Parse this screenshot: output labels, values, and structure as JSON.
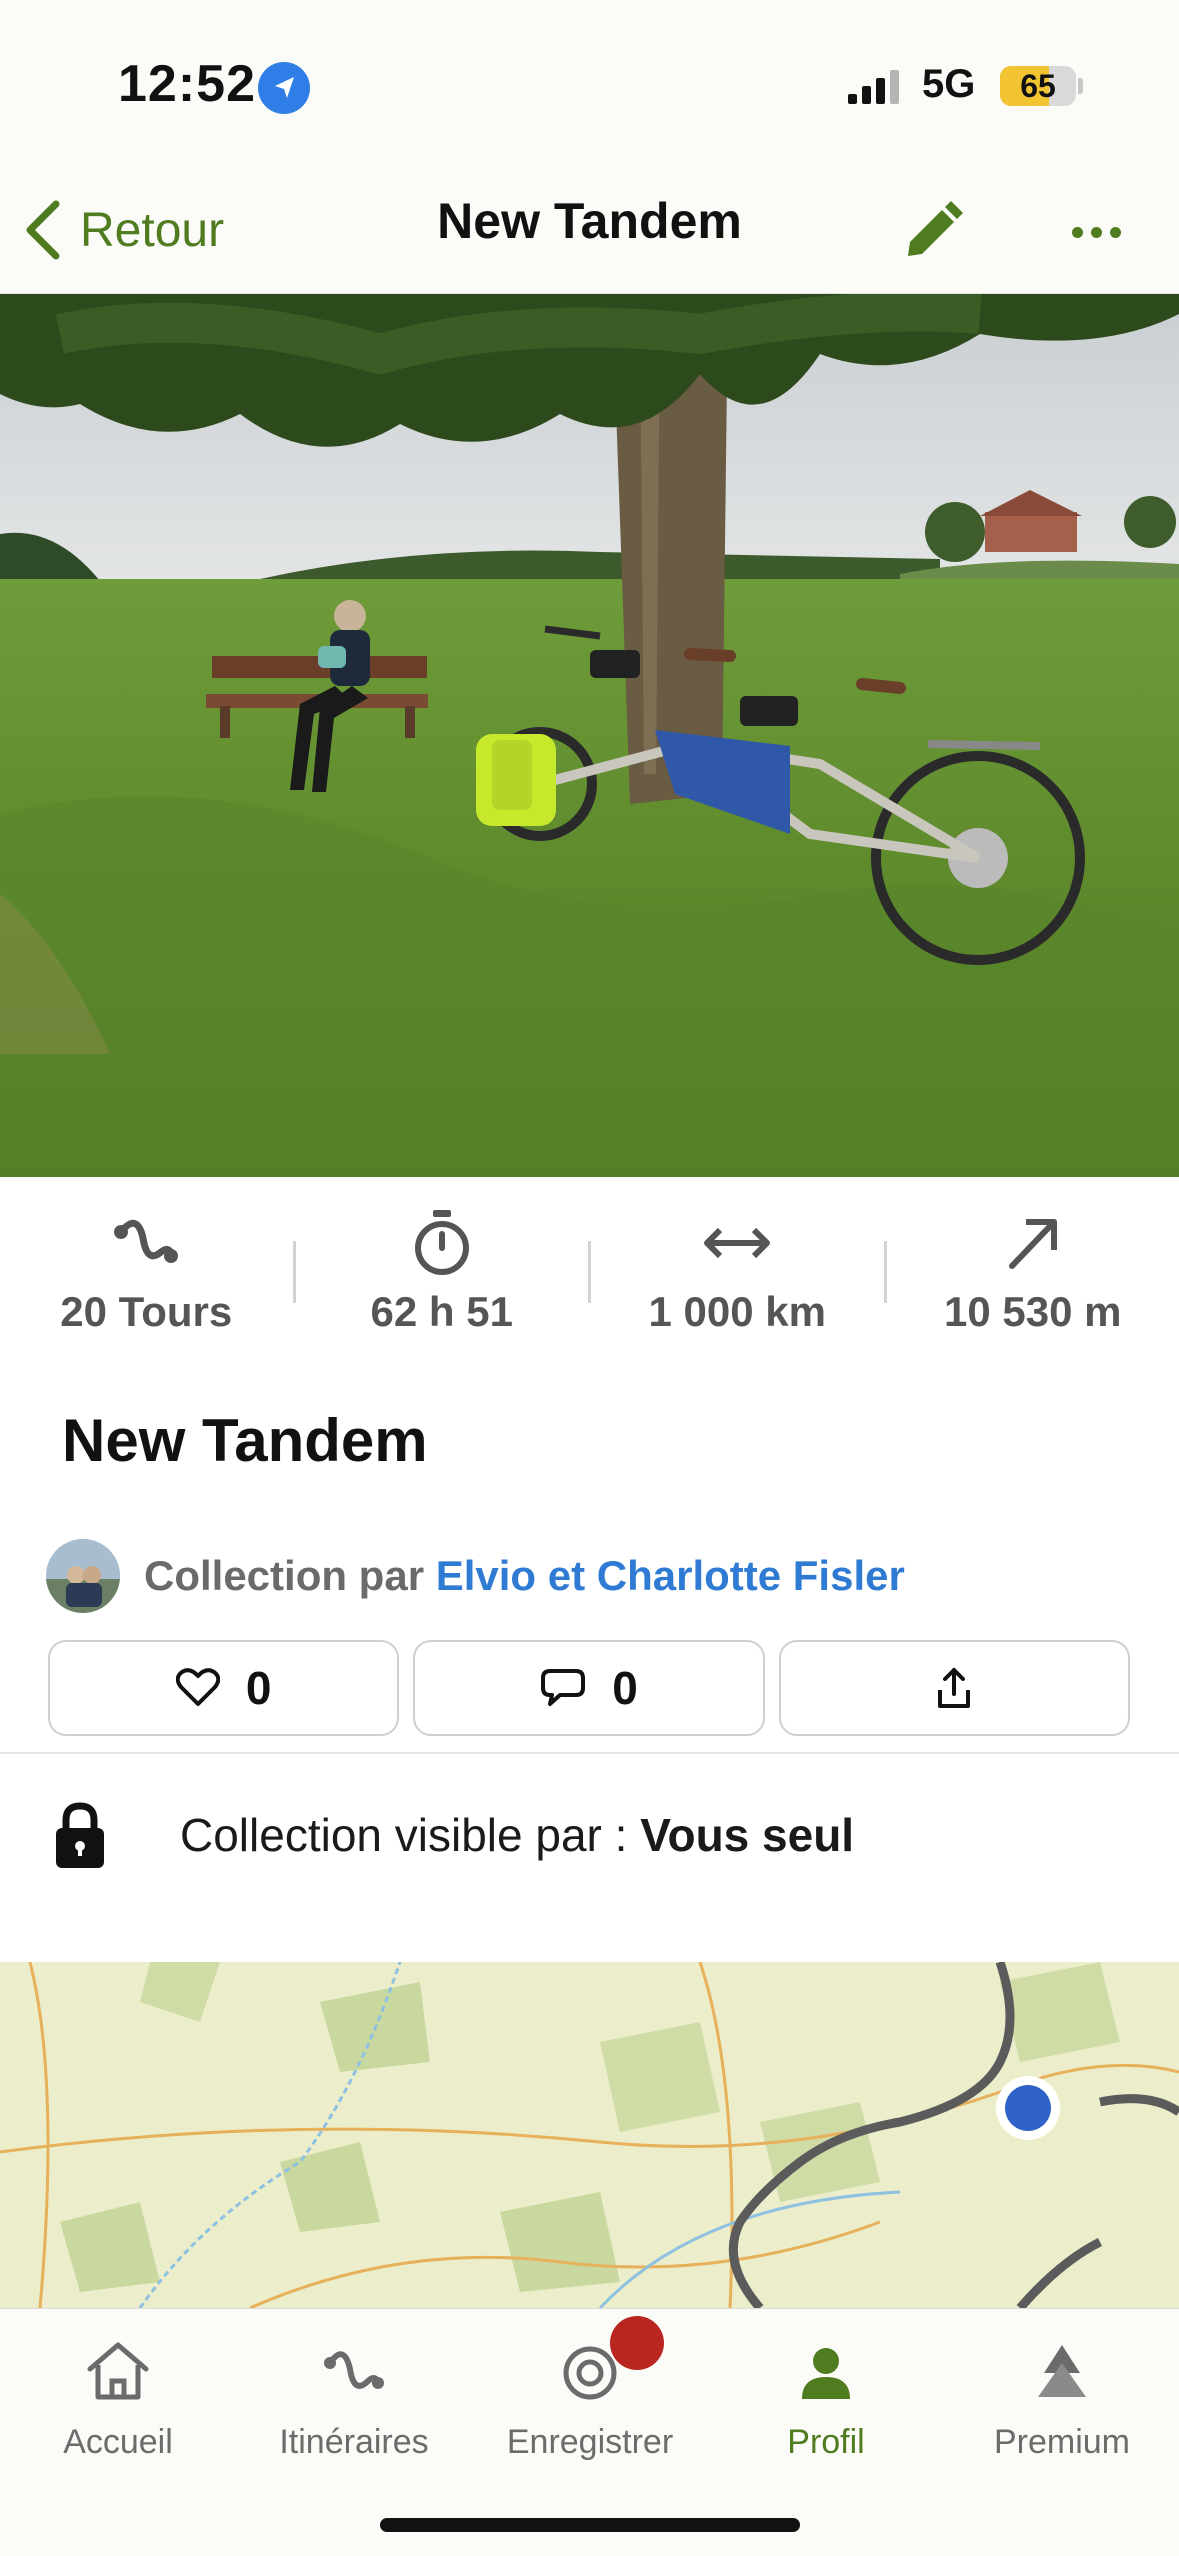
{
  "status_bar": {
    "time": "12:52",
    "network": "5G",
    "battery": "65",
    "battery_level": 0.65,
    "battery_color": "#f2c431"
  },
  "nav": {
    "back_label": "Retour",
    "title": "New Tandem",
    "accent_color": "#4f7c1f",
    "icons": [
      "chevron-left-icon",
      "pencil-icon",
      "more-icon"
    ]
  },
  "hero": {
    "description_icon": "photo"
  },
  "stats": [
    {
      "icon": "route-icon",
      "value": "20 Tours"
    },
    {
      "icon": "stopwatch-icon",
      "value": "62 h 51"
    },
    {
      "icon": "distance-arrows-icon",
      "value": "1 000 km"
    },
    {
      "icon": "elevation-arrow-icon",
      "value": "10 530 m"
    }
  ],
  "collection": {
    "title": "New Tandem",
    "by_prefix": "Collection par",
    "author": "Elvio et Charlotte Fisler",
    "link_color": "#2f7bd4"
  },
  "actions": {
    "likes": "0",
    "comments": "0"
  },
  "visibility": {
    "prefix": "Collection visible par :",
    "value": "Vous seul"
  },
  "tabbar": {
    "items": [
      {
        "label": "Accueil",
        "icon": "home-icon"
      },
      {
        "label": "Itinéraires",
        "icon": "route-icon"
      },
      {
        "label": "Enregistrer",
        "icon": "record-icon"
      },
      {
        "label": "Profil",
        "icon": "person-icon"
      },
      {
        "label": "Premium",
        "icon": "mountain-icon"
      }
    ],
    "active_index": 3,
    "active_color": "#4f7c1f",
    "badge_color": "#b8261f"
  }
}
